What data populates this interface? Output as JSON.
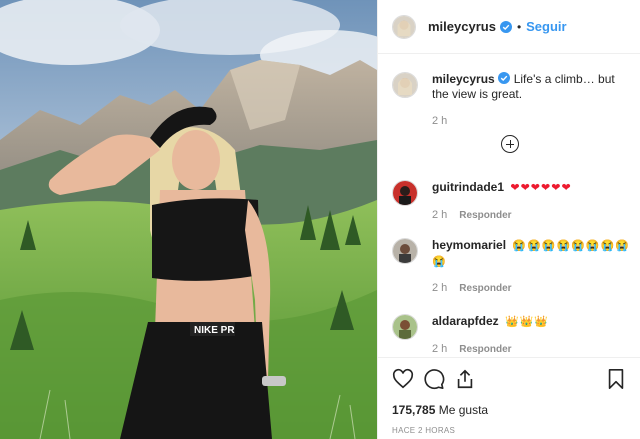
{
  "post": {
    "username": "mileycyrus",
    "follow_label": "Seguir",
    "separator": "•"
  },
  "caption": {
    "username": "mileycyrus",
    "text": "Life's a climb… but the view is great.",
    "time": "2 h"
  },
  "comments": [
    {
      "username": "guitrindade1",
      "text": "❤❤❤❤❤❤",
      "time": "2 h",
      "reply_label": "Responder"
    },
    {
      "username": "heymomariel",
      "text": "😭😭😭😭😭😭😭😭😭",
      "time": "2 h",
      "reply_label": "Responder"
    },
    {
      "username": "aldarapfdez",
      "text": "👑👑👑",
      "time": "2 h",
      "reply_label": "Responder"
    }
  ],
  "actions": {
    "likes_count": "175,785",
    "likes_label": "Me gusta",
    "posted_ago": "HACE 2 HORAS"
  },
  "icons": [
    "verified-badge-icon",
    "load-more-icon",
    "heart-icon",
    "comment-icon",
    "share-icon",
    "bookmark-icon"
  ],
  "colors": {
    "accent": "#3897f0",
    "heart": "#ed1b2f",
    "muted": "#8e8e8e"
  }
}
